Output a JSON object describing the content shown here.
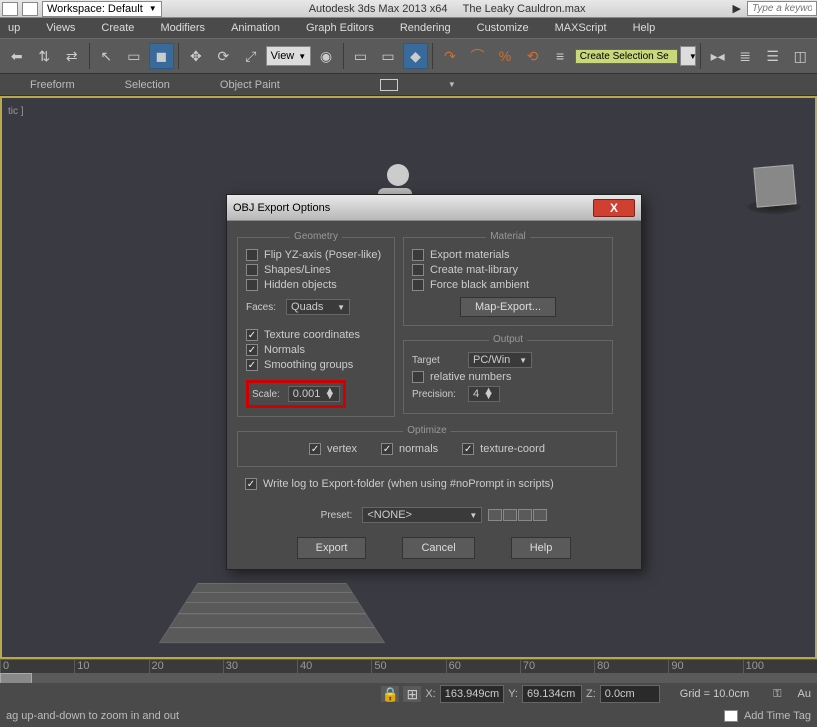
{
  "title": {
    "workspace": "Workspace: Default",
    "app": "Autodesk 3ds Max 2013 x64",
    "file": "The Leaky Cauldron.max",
    "search_placeholder": "Type a keywo"
  },
  "menu": {
    "up": "up",
    "views": "Views",
    "create": "Create",
    "modifiers": "Modifiers",
    "animation": "Animation",
    "graph": "Graph Editors",
    "rendering": "Rendering",
    "customize": "Customize",
    "maxscript": "MAXScript",
    "help": "Help"
  },
  "toolbar": {
    "view": "View",
    "cs_label": "Create Selection Se"
  },
  "subtoolbar": {
    "freeform": "Freeform",
    "selection": "Selection",
    "object_paint": "Object Paint"
  },
  "viewport": {
    "label": "tic ]"
  },
  "dialog": {
    "title": "OBJ Export Options",
    "geometry": {
      "legend": "Geometry",
      "flip_yz": "Flip YZ-axis (Poser-like)",
      "shapes": "Shapes/Lines",
      "hidden": "Hidden objects",
      "faces_label": "Faces:",
      "faces_value": "Quads",
      "tex_coords": "Texture coordinates",
      "normals": "Normals",
      "smoothing": "Smoothing groups",
      "scale_label": "Scale:",
      "scale_value": "0.001"
    },
    "material": {
      "legend": "Material",
      "export_mat": "Export materials",
      "create_lib": "Create mat-library",
      "force_black": "Force black ambient",
      "map_export": "Map-Export..."
    },
    "output": {
      "legend": "Output",
      "target_label": "Target",
      "target_value": "PC/Win",
      "relative": "relative numbers",
      "precision_label": "Precision:",
      "precision_value": "4"
    },
    "optimize": {
      "legend": "Optimize",
      "vertex": "vertex",
      "normals": "normals",
      "texture": "texture-coord"
    },
    "write_log": "Write log to Export-folder (when using #noPrompt in scripts)",
    "preset_label": "Preset:",
    "preset_value": "<NONE>",
    "export": "Export",
    "cancel": "Cancel",
    "help": "Help"
  },
  "timeline": {
    "t0": "0",
    "t10": "10",
    "t20": "20",
    "t30": "30",
    "t40": "40",
    "t50": "50",
    "t60": "60",
    "t70": "70",
    "t80": "80",
    "t90": "90",
    "t100": "100"
  },
  "coords": {
    "x_label": "X:",
    "x": "163.949cm",
    "y_label": "Y:",
    "y": "69.134cm",
    "z_label": "Z:",
    "z": "0.0cm",
    "grid": "Grid = 10.0cm",
    "au": "Au"
  },
  "status": {
    "hint": "ag up-and-down to zoom in and out",
    "add_tag": "Add Time Tag"
  }
}
